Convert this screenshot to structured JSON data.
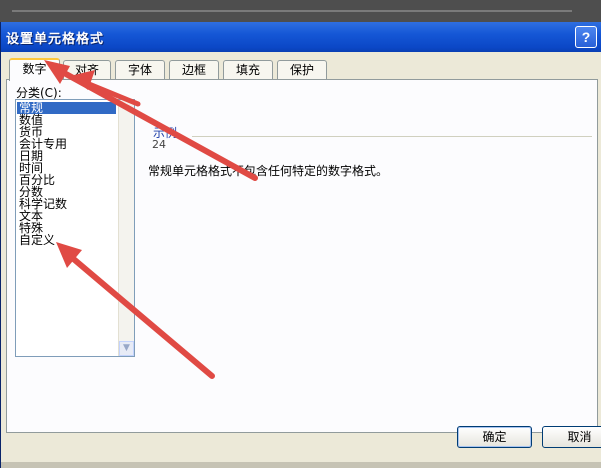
{
  "dialog": {
    "title": "设置单元格格式",
    "help_label": "?"
  },
  "tabs": [
    {
      "label": "数字"
    },
    {
      "label": "对齐"
    },
    {
      "label": "字体"
    },
    {
      "label": "边框"
    },
    {
      "label": "填充"
    },
    {
      "label": "保护"
    }
  ],
  "category": {
    "label": "分类(C):",
    "selected": "常规",
    "items": [
      "常规",
      "数值",
      "货币",
      "会计专用",
      "日期",
      "时间",
      "百分比",
      "分数",
      "科学记数",
      "文本",
      "特殊",
      "自定义"
    ]
  },
  "example": {
    "label": "示例",
    "value": "24"
  },
  "description": "常规单元格格式不包含任何特定的数字格式。",
  "buttons": {
    "ok": "确定",
    "cancel": "取消"
  },
  "annotation_color": "#e04a44"
}
